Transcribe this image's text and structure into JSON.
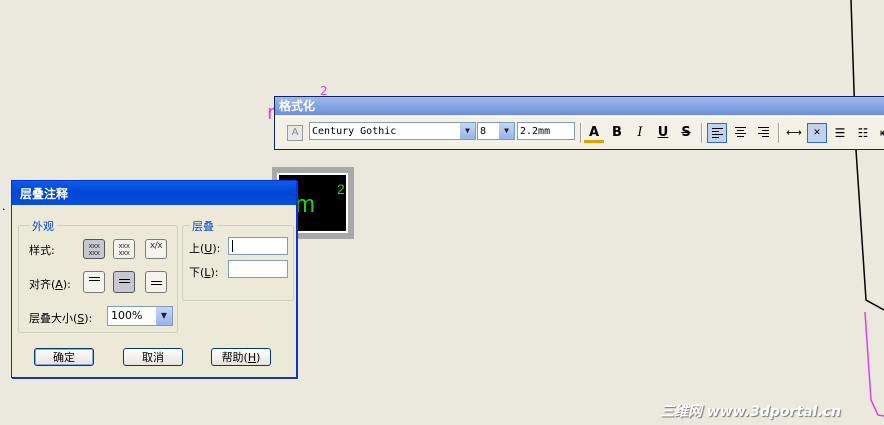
{
  "canvas": {
    "magenta_marks": [
      "2",
      "r"
    ],
    "dialog_edge_mark": "."
  },
  "toolbar": {
    "title": "格式化",
    "font": "Century Gothic",
    "size": "8",
    "height": "2.2mm",
    "buttons": {
      "color": "A",
      "bold": "B",
      "italic": "I",
      "underline": "U",
      "strike": "S"
    },
    "font_icon_glyph": "A"
  },
  "preview": {
    "text": "mm",
    "superscript": "2"
  },
  "dialog": {
    "title": "层叠注释",
    "appearance": {
      "label": "外观",
      "style_label": "样式:",
      "align_label_prefix": "对齐(",
      "align_label_key": "A",
      "align_label_suffix": "):",
      "size_label_prefix": "层叠大小(",
      "size_label_key": "S",
      "size_label_suffix": "):",
      "size_value": "100%",
      "style_options": [
        {
          "top": "xxx",
          "bottom": "xxx",
          "selected": true
        },
        {
          "top": "xxx",
          "bottom": "xxx",
          "selected": false
        },
        {
          "top": "x/",
          "bottom": "x",
          "selected": false
        }
      ]
    },
    "stack": {
      "label": "层叠",
      "upper_label_prefix": "上(",
      "upper_label_key": "U",
      "upper_label_suffix": "):",
      "upper_value": "",
      "lower_label_prefix": "下(",
      "lower_label_key": "L",
      "lower_label_suffix": "):",
      "lower_value": ""
    },
    "buttons": {
      "ok": "确定",
      "cancel": "取消",
      "help_prefix": "帮助(",
      "help_key": "H",
      "help_suffix": ")"
    }
  },
  "watermark": "三维网 www.3dportal.cn"
}
